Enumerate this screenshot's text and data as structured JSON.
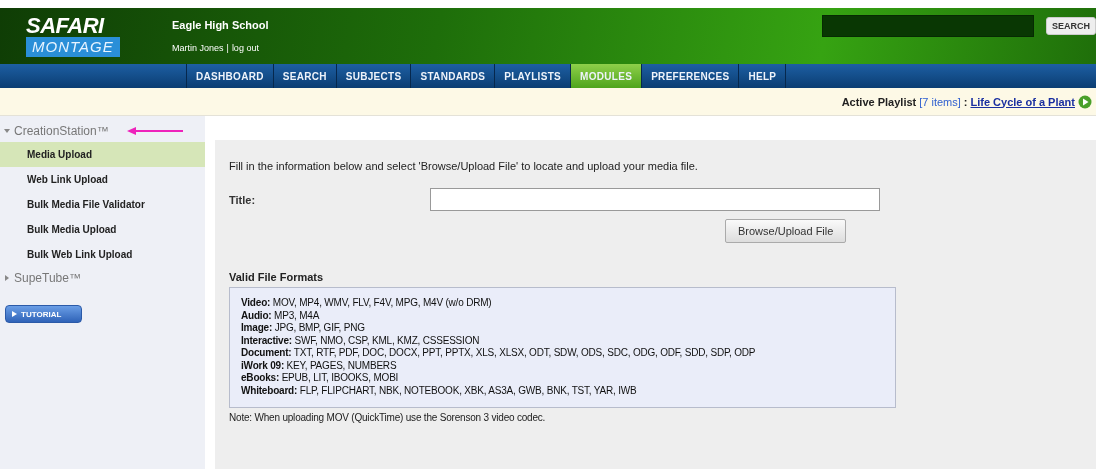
{
  "header": {
    "logo": {
      "top": "SAFARI",
      "bottom": "MONTAGE"
    },
    "school": "Eagle High School",
    "user": "Martin Jones",
    "separator": "|",
    "logout": "log out",
    "search_button": "SEARCH"
  },
  "nav": [
    {
      "label": "DASHBOARD",
      "selected": false
    },
    {
      "label": "SEARCH",
      "selected": false
    },
    {
      "label": "SUBJECTS",
      "selected": false
    },
    {
      "label": "STANDARDS",
      "selected": false
    },
    {
      "label": "PLAYLISTS",
      "selected": false
    },
    {
      "label": "MODULES",
      "selected": true
    },
    {
      "label": "PREFERENCES",
      "selected": false
    },
    {
      "label": "HELP",
      "selected": false
    }
  ],
  "playlist_bar": {
    "label": "Active Playlist",
    "count": "[7 items]",
    "colon": ":",
    "playlist": "Life Cycle of a Plant"
  },
  "sidebar": {
    "sections": [
      {
        "label": "CreationStation™",
        "expanded": true,
        "children": [
          {
            "label": "Media Upload",
            "selected": true
          },
          {
            "label": "Web Link Upload",
            "selected": false
          },
          {
            "label": "Bulk Media File Validator",
            "selected": false
          },
          {
            "label": "Bulk Media Upload",
            "selected": false
          },
          {
            "label": "Bulk Web Link Upload",
            "selected": false
          }
        ]
      },
      {
        "label": "SupeTube™",
        "expanded": false
      }
    ],
    "tutorial_button": "TUTORIAL"
  },
  "main": {
    "instructions": "Fill in the information below and select 'Browse/Upload File' to locate and upload your media file.",
    "title_label": "Title:",
    "browse_button": "Browse/Upload File",
    "formats_heading": "Valid File Formats",
    "formats": [
      "**Video:** MOV, MP4, WMV, FLV, F4V, MPG, M4V (w/o DRM)",
      "**Audio:** MP3, M4A",
      "**Image:** JPG, BMP, GIF, PNG",
      "**Interactive:** SWF, NMO, CSP, KML, KMZ, CSSESSION",
      "**Document:** TXT, RTF, PDF, DOC, DOCX, PPT, PPTX, XLS, XLSX, ODT, SDW, ODS, SDC, ODG, ODF, SDD, SDP, ODP",
      "**iWork 09:** KEY, PAGES, NUMBERS",
      "**eBooks:** EPUB, LIT, IBOOKS, MOBI",
      "**Whiteboard:** FLP, FLIPCHART, NBK, NOTEBOOK, XBK, AS3A, GWB, BNK, TST, YAR, IWB"
    ],
    "note": "Note: When uploading MOV (QuickTime) use the Sorenson 3 video codec."
  }
}
